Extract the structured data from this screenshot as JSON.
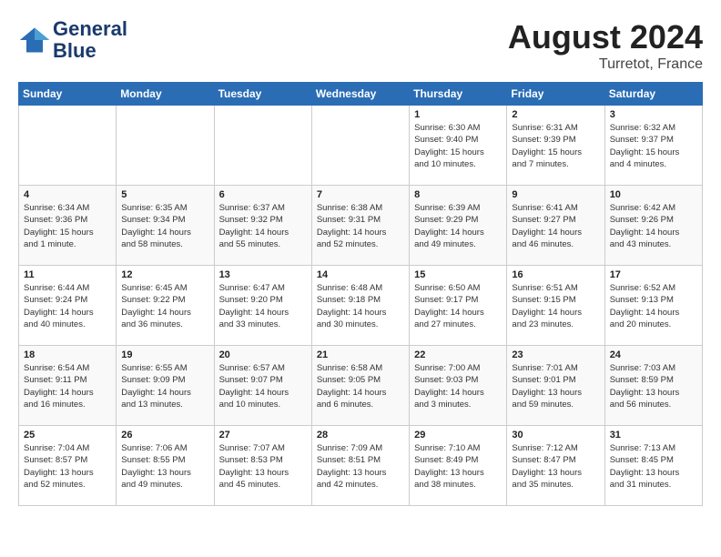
{
  "header": {
    "logo_line1": "General",
    "logo_line2": "Blue",
    "month": "August 2024",
    "location": "Turretot, France"
  },
  "weekdays": [
    "Sunday",
    "Monday",
    "Tuesday",
    "Wednesday",
    "Thursday",
    "Friday",
    "Saturday"
  ],
  "weeks": [
    [
      {
        "day": "",
        "info": "",
        "empty": true
      },
      {
        "day": "",
        "info": "",
        "empty": true
      },
      {
        "day": "",
        "info": "",
        "empty": true
      },
      {
        "day": "",
        "info": "",
        "empty": true
      },
      {
        "day": "1",
        "info": "Sunrise: 6:30 AM\nSunset: 9:40 PM\nDaylight: 15 hours\nand 10 minutes."
      },
      {
        "day": "2",
        "info": "Sunrise: 6:31 AM\nSunset: 9:39 PM\nDaylight: 15 hours\nand 7 minutes."
      },
      {
        "day": "3",
        "info": "Sunrise: 6:32 AM\nSunset: 9:37 PM\nDaylight: 15 hours\nand 4 minutes."
      }
    ],
    [
      {
        "day": "4",
        "info": "Sunrise: 6:34 AM\nSunset: 9:36 PM\nDaylight: 15 hours\nand 1 minute."
      },
      {
        "day": "5",
        "info": "Sunrise: 6:35 AM\nSunset: 9:34 PM\nDaylight: 14 hours\nand 58 minutes."
      },
      {
        "day": "6",
        "info": "Sunrise: 6:37 AM\nSunset: 9:32 PM\nDaylight: 14 hours\nand 55 minutes."
      },
      {
        "day": "7",
        "info": "Sunrise: 6:38 AM\nSunset: 9:31 PM\nDaylight: 14 hours\nand 52 minutes."
      },
      {
        "day": "8",
        "info": "Sunrise: 6:39 AM\nSunset: 9:29 PM\nDaylight: 14 hours\nand 49 minutes."
      },
      {
        "day": "9",
        "info": "Sunrise: 6:41 AM\nSunset: 9:27 PM\nDaylight: 14 hours\nand 46 minutes."
      },
      {
        "day": "10",
        "info": "Sunrise: 6:42 AM\nSunset: 9:26 PM\nDaylight: 14 hours\nand 43 minutes."
      }
    ],
    [
      {
        "day": "11",
        "info": "Sunrise: 6:44 AM\nSunset: 9:24 PM\nDaylight: 14 hours\nand 40 minutes."
      },
      {
        "day": "12",
        "info": "Sunrise: 6:45 AM\nSunset: 9:22 PM\nDaylight: 14 hours\nand 36 minutes."
      },
      {
        "day": "13",
        "info": "Sunrise: 6:47 AM\nSunset: 9:20 PM\nDaylight: 14 hours\nand 33 minutes."
      },
      {
        "day": "14",
        "info": "Sunrise: 6:48 AM\nSunset: 9:18 PM\nDaylight: 14 hours\nand 30 minutes."
      },
      {
        "day": "15",
        "info": "Sunrise: 6:50 AM\nSunset: 9:17 PM\nDaylight: 14 hours\nand 27 minutes."
      },
      {
        "day": "16",
        "info": "Sunrise: 6:51 AM\nSunset: 9:15 PM\nDaylight: 14 hours\nand 23 minutes."
      },
      {
        "day": "17",
        "info": "Sunrise: 6:52 AM\nSunset: 9:13 PM\nDaylight: 14 hours\nand 20 minutes."
      }
    ],
    [
      {
        "day": "18",
        "info": "Sunrise: 6:54 AM\nSunset: 9:11 PM\nDaylight: 14 hours\nand 16 minutes."
      },
      {
        "day": "19",
        "info": "Sunrise: 6:55 AM\nSunset: 9:09 PM\nDaylight: 14 hours\nand 13 minutes."
      },
      {
        "day": "20",
        "info": "Sunrise: 6:57 AM\nSunset: 9:07 PM\nDaylight: 14 hours\nand 10 minutes."
      },
      {
        "day": "21",
        "info": "Sunrise: 6:58 AM\nSunset: 9:05 PM\nDaylight: 14 hours\nand 6 minutes."
      },
      {
        "day": "22",
        "info": "Sunrise: 7:00 AM\nSunset: 9:03 PM\nDaylight: 14 hours\nand 3 minutes."
      },
      {
        "day": "23",
        "info": "Sunrise: 7:01 AM\nSunset: 9:01 PM\nDaylight: 13 hours\nand 59 minutes."
      },
      {
        "day": "24",
        "info": "Sunrise: 7:03 AM\nSunset: 8:59 PM\nDaylight: 13 hours\nand 56 minutes."
      }
    ],
    [
      {
        "day": "25",
        "info": "Sunrise: 7:04 AM\nSunset: 8:57 PM\nDaylight: 13 hours\nand 52 minutes."
      },
      {
        "day": "26",
        "info": "Sunrise: 7:06 AM\nSunset: 8:55 PM\nDaylight: 13 hours\nand 49 minutes."
      },
      {
        "day": "27",
        "info": "Sunrise: 7:07 AM\nSunset: 8:53 PM\nDaylight: 13 hours\nand 45 minutes."
      },
      {
        "day": "28",
        "info": "Sunrise: 7:09 AM\nSunset: 8:51 PM\nDaylight: 13 hours\nand 42 minutes."
      },
      {
        "day": "29",
        "info": "Sunrise: 7:10 AM\nSunset: 8:49 PM\nDaylight: 13 hours\nand 38 minutes."
      },
      {
        "day": "30",
        "info": "Sunrise: 7:12 AM\nSunset: 8:47 PM\nDaylight: 13 hours\nand 35 minutes."
      },
      {
        "day": "31",
        "info": "Sunrise: 7:13 AM\nSunset: 8:45 PM\nDaylight: 13 hours\nand 31 minutes."
      }
    ]
  ]
}
